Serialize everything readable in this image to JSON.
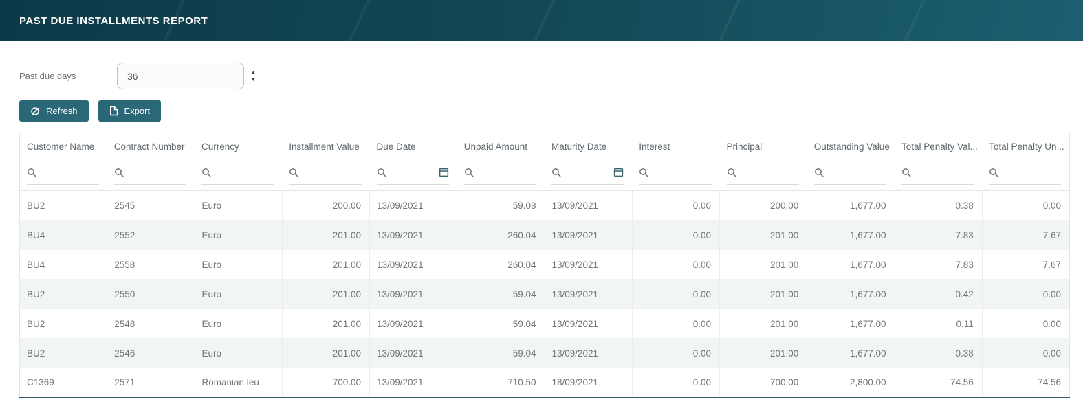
{
  "app": {
    "title": "PAST DUE INSTALLMENTS REPORT"
  },
  "controls": {
    "past_due_days": {
      "label": "Past due days",
      "value": "36"
    },
    "buttons": {
      "refresh": "Refresh",
      "export": "Export"
    }
  },
  "icons": {
    "refresh": "refresh-icon",
    "export": "export-icon",
    "filter": "search-icon",
    "date_picker": "calendar-icon",
    "spinner_up": "chevron-up-icon",
    "spinner_down": "chevron-down-icon"
  },
  "colors": {
    "header_bg": "#124654",
    "accent": "#2b6877",
    "row_alt": "#f2f5f6",
    "table_bottom_border": "#35596f"
  },
  "table": {
    "columns": [
      {
        "label": "Customer Name",
        "align": "left",
        "calendar": false
      },
      {
        "label": "Contract Number",
        "align": "left",
        "calendar": false
      },
      {
        "label": "Currency",
        "align": "left",
        "calendar": false
      },
      {
        "label": "Installment Value",
        "align": "right",
        "calendar": false
      },
      {
        "label": "Due Date",
        "align": "left",
        "calendar": true
      },
      {
        "label": "Unpaid Amount",
        "align": "right",
        "calendar": false
      },
      {
        "label": "Maturity Date",
        "align": "left",
        "calendar": true
      },
      {
        "label": "Interest",
        "align": "right",
        "calendar": false
      },
      {
        "label": "Principal",
        "align": "right",
        "calendar": false
      },
      {
        "label": "Outstanding Value",
        "align": "right",
        "calendar": false
      },
      {
        "label": "Total Penalty Val...",
        "align": "right",
        "calendar": false
      },
      {
        "label": "Total Penalty Un...",
        "align": "right",
        "calendar": false
      }
    ],
    "rows": [
      [
        "BU2",
        "2545",
        "Euro",
        "200.00",
        "13/09/2021",
        "59.08",
        "13/09/2021",
        "0.00",
        "200.00",
        "1,677.00",
        "0.38",
        "0.00"
      ],
      [
        "BU4",
        "2552",
        "Euro",
        "201.00",
        "13/09/2021",
        "260.04",
        "13/09/2021",
        "0.00",
        "201.00",
        "1,677.00",
        "7.83",
        "7.67"
      ],
      [
        "BU4",
        "2558",
        "Euro",
        "201.00",
        "13/09/2021",
        "260.04",
        "13/09/2021",
        "0.00",
        "201.00",
        "1,677.00",
        "7.83",
        "7.67"
      ],
      [
        "BU2",
        "2550",
        "Euro",
        "201.00",
        "13/09/2021",
        "59.04",
        "13/09/2021",
        "0.00",
        "201.00",
        "1,677.00",
        "0.42",
        "0.00"
      ],
      [
        "BU2",
        "2548",
        "Euro",
        "201.00",
        "13/09/2021",
        "59.04",
        "13/09/2021",
        "0.00",
        "201.00",
        "1,677.00",
        "0.11",
        "0.00"
      ],
      [
        "BU2",
        "2546",
        "Euro",
        "201.00",
        "13/09/2021",
        "59.04",
        "13/09/2021",
        "0.00",
        "201.00",
        "1,677.00",
        "0.38",
        "0.00"
      ],
      [
        "C1369",
        "2571",
        "Romanian leu",
        "700.00",
        "13/09/2021",
        "710.50",
        "18/09/2021",
        "0.00",
        "700.00",
        "2,800.00",
        "74.56",
        "74.56"
      ]
    ]
  }
}
